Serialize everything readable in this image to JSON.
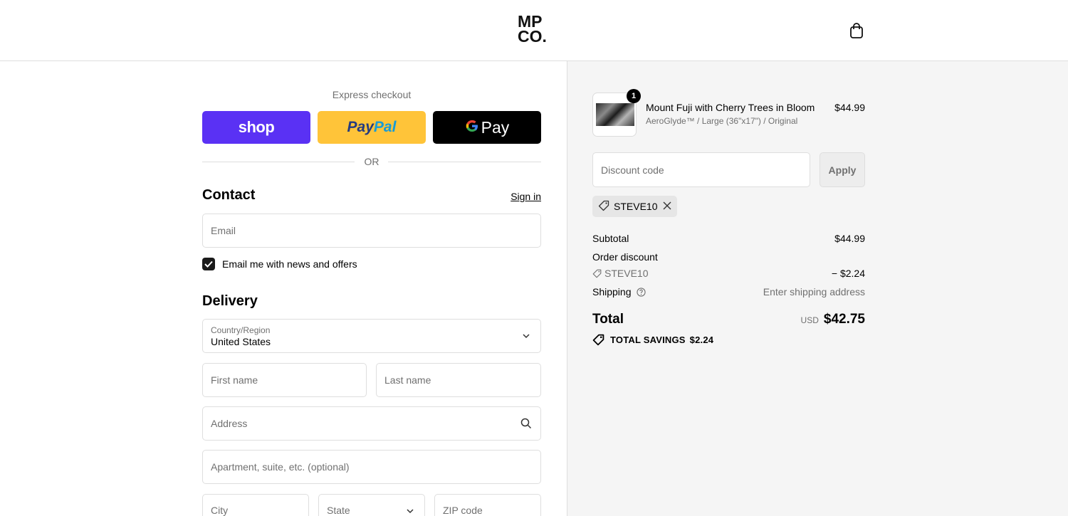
{
  "header": {
    "logo_line1": "MP",
    "logo_line2": "CO.",
    "cart_icon": "bag-icon"
  },
  "express": {
    "label": "Express checkout",
    "shop_label": "shop",
    "paypal_label_a": "Pay",
    "paypal_label_b": "Pal",
    "gpay_g": "G",
    "gpay_label": "Pay",
    "or_label": "OR"
  },
  "contact": {
    "title": "Contact",
    "sign_in": "Sign in",
    "email_placeholder": "Email",
    "newsletter_label": "Email me with news and offers",
    "newsletter_checked": true
  },
  "delivery": {
    "title": "Delivery",
    "country_label": "Country/Region",
    "country_value": "United States",
    "first_name_placeholder": "First name",
    "last_name_placeholder": "Last name",
    "address_placeholder": "Address",
    "apartment_placeholder": "Apartment, suite, etc. (optional)",
    "city_placeholder": "City",
    "state_placeholder": "State",
    "zip_placeholder": "ZIP code"
  },
  "summary": {
    "item": {
      "quantity": "1",
      "name": "Mount Fuji with Cherry Trees in Bloom",
      "variant": "AeroGlyde™ / Large (36\"x17\") / Original",
      "price": "$44.99"
    },
    "discount_placeholder": "Discount code",
    "apply_label": "Apply",
    "applied_code": "STEVE10",
    "subtotal_label": "Subtotal",
    "subtotal_value": "$44.99",
    "order_discount_label": "Order discount",
    "discount_code_line": "STEVE10",
    "discount_value": "− $2.24",
    "shipping_label": "Shipping",
    "shipping_value": "Enter shipping address",
    "total_label": "Total",
    "currency": "USD",
    "total_value": "$42.75",
    "savings_label": "TOTAL SAVINGS",
    "savings_value": "$2.24"
  },
  "colors": {
    "shop_purple": "#5a31f4",
    "paypal_yellow": "#ffc439",
    "gpay_black": "#000000",
    "panel_bg": "#f5f5f5"
  }
}
